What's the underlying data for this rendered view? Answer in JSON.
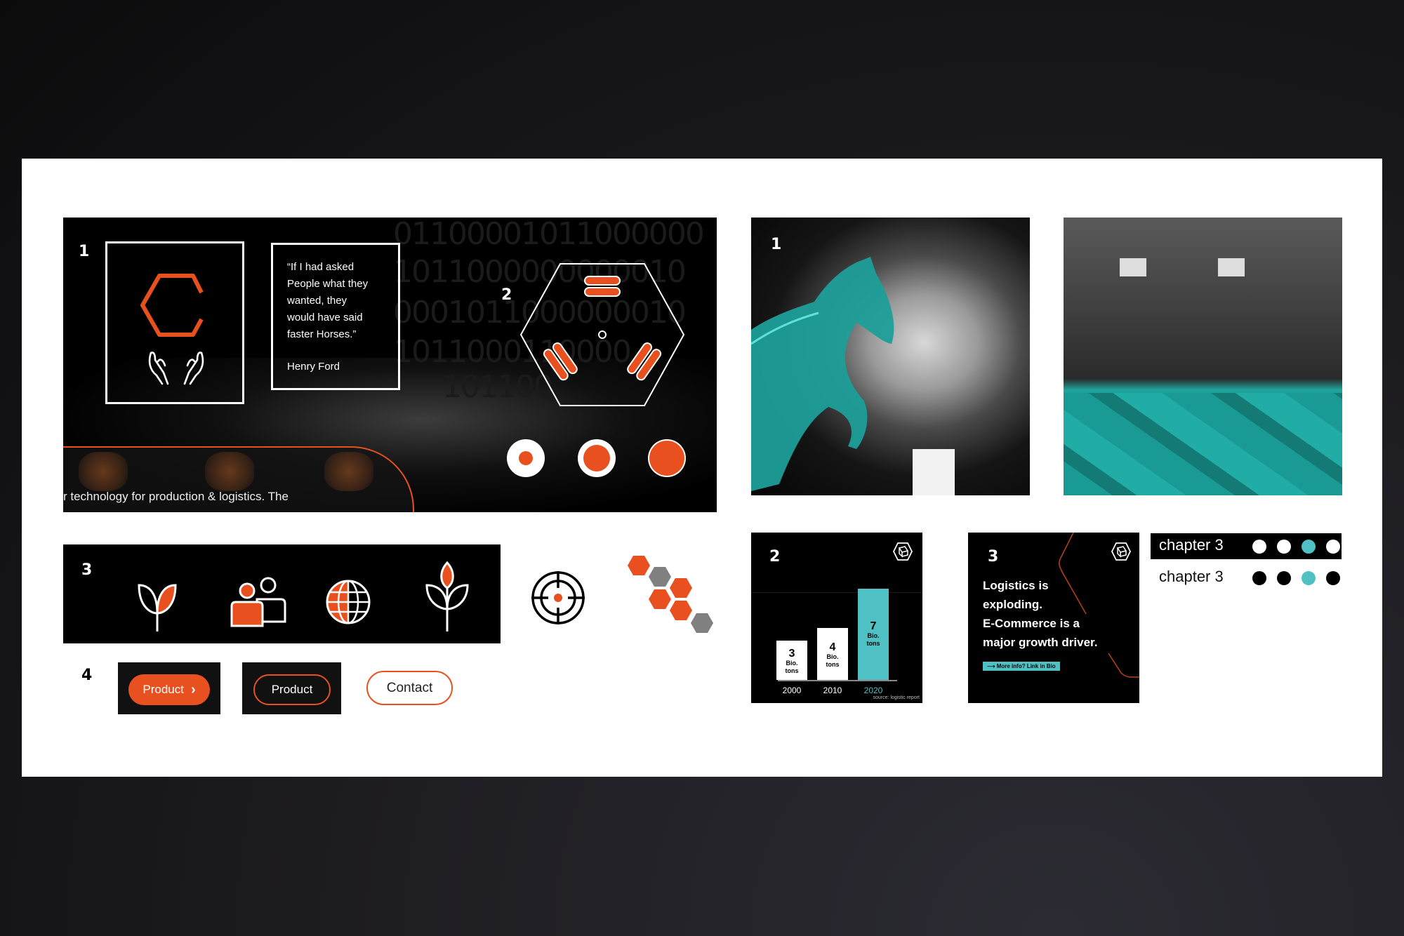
{
  "brand": {
    "accent": "#e8511f",
    "teal": "#4fc0c4",
    "dark": "#000000",
    "grey": "#808080"
  },
  "hero": {
    "section_number": "1",
    "section_number_2": "2",
    "logo_icon": "hexagon-c-logo-with-hands",
    "quote": {
      "lines": [
        "“If I had asked",
        "People what they",
        "wanted, they",
        "would have said",
        "faster Horses.”"
      ],
      "author": "Henry Ford"
    },
    "tagline": "r technology for production & logistics. The",
    "binary_rows": [
      "01100001011000000",
      "1011000000000010",
      "0001011000000010",
      "1011000110000",
      "101100"
    ],
    "diagram_icon": "hexagon-robot-platform",
    "radio_states": [
      {
        "name": "small-dot",
        "fill": 0.35
      },
      {
        "name": "medium-dot",
        "fill": 0.7
      },
      {
        "name": "full-dot",
        "fill": 1.0
      }
    ]
  },
  "photos": [
    {
      "number": "1",
      "subject": "Henry Ford portrait with teal horse"
    },
    {
      "subject": "warehouse with teal parcel boxes"
    }
  ],
  "icons_panel": {
    "section_number": "3",
    "icons": [
      "sprout-icon",
      "people-icon",
      "globe-icon",
      "plant-icon"
    ]
  },
  "loose_icons": [
    "target-icon",
    "hexagon-cluster-icon"
  ],
  "buttons_section": {
    "section_number": "4",
    "primary_label": "Product",
    "primary_icon": "›",
    "outline_dark_label": "Product",
    "outline_light_label": "Contact"
  },
  "chart_card": {
    "section_number": "2",
    "source": "source: logistic report",
    "icon": "cube-hexagon-icon"
  },
  "chart_data": {
    "type": "bar",
    "title": "",
    "categories": [
      "2000",
      "2010",
      "2020"
    ],
    "values": [
      3,
      4,
      7
    ],
    "unit_line1": "Bio.",
    "unit_line2": "tons",
    "highlight_index": 2,
    "xlabel": "",
    "ylabel": "",
    "ylim": [
      0,
      7
    ],
    "grid": false,
    "source": "source: logistic report"
  },
  "text_card": {
    "section_number": "3",
    "headline_lines": [
      "Logistics is",
      "exploding.",
      "E-Commerce is a",
      "major growth driver."
    ],
    "cta_label": "More info? Link in Bio",
    "cta_arrow": "⟶",
    "icon": "cube-hexagon-icon"
  },
  "chapter_indicators": [
    {
      "label": "chapter 3",
      "theme": "dark",
      "dots": 4,
      "active": 2
    },
    {
      "label": "chapter 3",
      "theme": "light",
      "dots": 4,
      "active": 2
    }
  ]
}
